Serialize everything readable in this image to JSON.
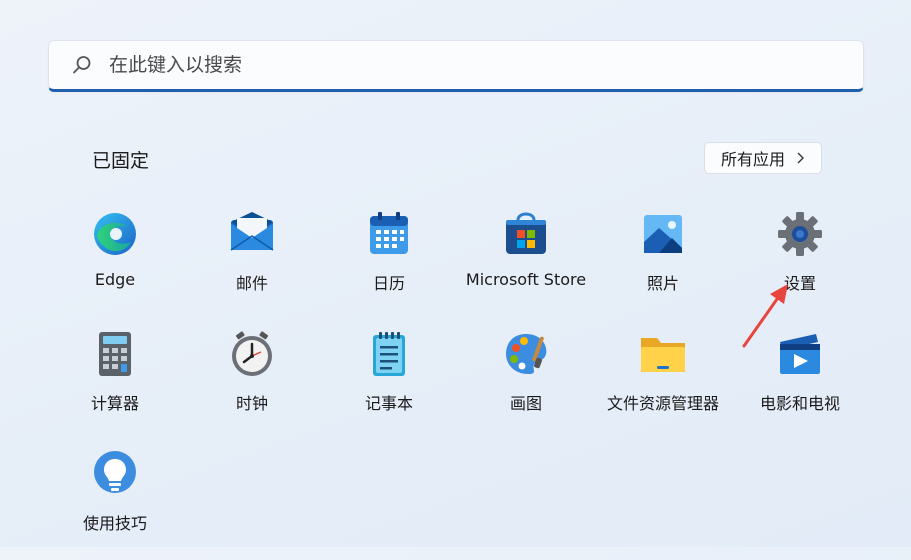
{
  "search": {
    "placeholder": "在此键入以搜索"
  },
  "pinned": {
    "title": "已固定",
    "all_apps_label": "所有应用",
    "apps": [
      {
        "label": "Edge",
        "icon": "edge-icon"
      },
      {
        "label": "邮件",
        "icon": "mail-icon"
      },
      {
        "label": "日历",
        "icon": "calendar-icon"
      },
      {
        "label": "Microsoft Store",
        "icon": "store-icon"
      },
      {
        "label": "照片",
        "icon": "photos-icon"
      },
      {
        "label": "设置",
        "icon": "gear-icon"
      },
      {
        "label": "计算器",
        "icon": "calculator-icon"
      },
      {
        "label": "时钟",
        "icon": "clock-icon"
      },
      {
        "label": "记事本",
        "icon": "notepad-icon"
      },
      {
        "label": "画图",
        "icon": "paint-icon"
      },
      {
        "label": "文件资源管理器",
        "icon": "folder-icon"
      },
      {
        "label": "电影和电视",
        "icon": "movies-icon"
      },
      {
        "label": "使用技巧",
        "icon": "tips-icon"
      }
    ]
  },
  "colors": {
    "accent": "#1f5fae",
    "arrow": "#e8453c"
  }
}
